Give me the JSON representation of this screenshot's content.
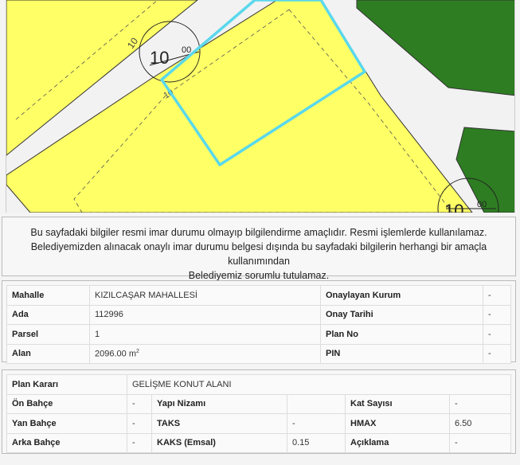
{
  "map": {
    "labels": {
      "contour_small": "10",
      "contour_big": "10",
      "contour_sup": "00",
      "contour_small2": "10",
      "contour_big2": "10",
      "contour_sup2": "00"
    },
    "colors": {
      "zone_yellow": "#ffff66",
      "green": "#2e7d22",
      "parcel_outline": "#5ad8ec",
      "road": "#f2f2f2"
    }
  },
  "notice": {
    "line1": "Bu sayfadaki bilgiler resmi imar durumu olmayıp bilgilendirme amaçlıdır. Resmi işlemlerde kullanılamaz.",
    "line2": "Belediyemizden alınacak onaylı imar durumu belgesi dışında bu sayfadaki bilgilerin herhangi bir amaçla kullanımından",
    "line3": "Belediyemiz sorumlu tutulamaz."
  },
  "parcel_info": {
    "mahalle_label": "Mahalle",
    "mahalle_value": "KIZILCAŞAR MAHALLESİ",
    "onaylayan_label": "Onaylayan Kurum",
    "onaylayan_value": "-",
    "ada_label": "Ada",
    "ada_value": "112996",
    "onay_tarihi_label": "Onay Tarihi",
    "onay_tarihi_value": "-",
    "parsel_label": "Parsel",
    "parsel_value": "1",
    "plan_no_label": "Plan No",
    "plan_no_value": "-",
    "alan_label": "Alan",
    "alan_value": "2096.00 m",
    "alan_unit_sup": "2",
    "pin_label": "PIN",
    "pin_value": "-"
  },
  "plan_info": {
    "plan_karari_label": "Plan Kararı",
    "plan_karari_value": "GELİŞME KONUT ALANI",
    "on_bahce_label": "Ön Bahçe",
    "on_bahce_value": "-",
    "yapi_nizami_label": "Yapı Nizamı",
    "yapi_nizami_value": "",
    "kat_sayisi_label": "Kat Sayısı",
    "kat_sayisi_value": "-",
    "yan_bahce_label": "Yan Bahçe",
    "yan_bahce_value": "-",
    "taks_label": "TAKS",
    "taks_value": "-",
    "hmax_label": "HMAX",
    "hmax_value": "6.50",
    "arka_bahce_label": "Arka Bahçe",
    "arka_bahce_value": "-",
    "kaks_label": "KAKS (Emsal)",
    "kaks_value": "0.15",
    "aciklama_label": "Açıklama",
    "aciklama_value": "-"
  }
}
